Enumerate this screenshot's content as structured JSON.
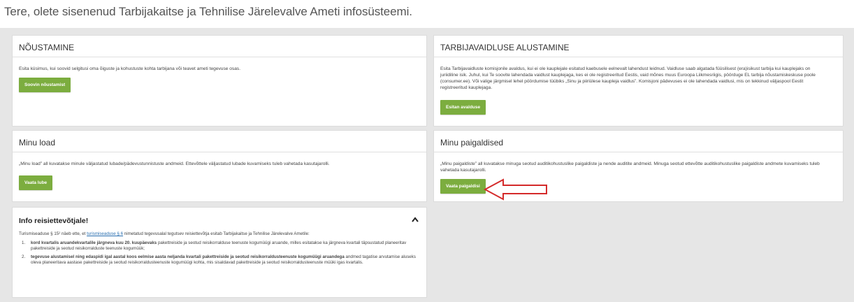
{
  "welcome_text": "Tere, olete sisenenud Tarbijakaitse ja Tehnilise Järelevalve Ameti infosüsteemi.",
  "cards": {
    "noustamine": {
      "title": "NÕUSTAMINE",
      "text": "Esita küsimus, kui soovid selgitusi oma õiguste ja kohustuste kohta tarbijana või teavet ameti tegevuse osas.",
      "button": "Soovin nõustamist"
    },
    "tarbijavaidlus": {
      "title": "TARBIJAVAIDLUSE ALUSTAMINE",
      "text": "Esita Tarbijavaidluste komisjonile avaldus, kui ei ole kauplejale esitatud kaebusele eelnevalt lahendust leidnud. Vaidluse saab algatada füüsilisest (era)isikust tarbija kui kauplejaks on juriidiline isik. Juhul, kui Te soovite lahendada vaidlust kauplejaga, kes ei ole registreeritud Eestis, vaid mõnes muus Euroopa Liikmesriigis, pöörduge EL tarbija nõustamiskeskuse poole (consumer.ee). Või valige järgmisel lehel pöördumise tüübiks „Sinu ja piiriülese kaupleja vaidlus”. Komisjoni pädevuses ei ole lahendada vaidlusi, mis on tekkinud väljaspool Eestit registreeritud kauplejaga.",
      "button": "Esitan avalduse"
    },
    "minu_load": {
      "title": "Minu load",
      "text": "„Minu load” all kuvatakse minule väljastatud lubade/pädevustunnistuste andmeid. Ettevõttele väljastatud lubade kuvamiseks tuleb vahetada kasutajarolli.",
      "button": "Vaata lube"
    },
    "minu_paigaldised": {
      "title": "Minu paigaldised",
      "text": "„Minu paigaldiste” all kuvatakse minuga seotud auditikohustuslike paigaldiste ja nende auditite andmeid. Minuga seotud ettevõtte auditikohustuslike paigaldiste andmete kuvamiseks tuleb vahetada kasutajarolli.",
      "button": "Vaata paigaldisi"
    }
  },
  "info": {
    "title": "Info reisiettevõtjale!",
    "intro_before": "Turismiseaduse § 15² näeb ette, et",
    "intro_link": "turismiseaduse § 6",
    "intro_after": "nimetatud tegevusalal tegutsev reisiettevõtja esitab Tarbijakaitse ja Tehnilise Järelevalve Ametile:",
    "items": [
      {
        "num": "1.",
        "bold": "kord kvartalis aruandekvartalile järgneva kuu 20. kuupäevaks",
        "rest": "pakettreiside ja seotud reisikorralduse teenuste kogumüügi aruande, milles esitatakse ka järgneva kvartali täpsustatud planeeritav pakettreiside ja seotud reisikorralduste teenuste kogumüük;"
      },
      {
        "num": "2.",
        "bold": "tegevuse alustamisel ning edaspidi igal aastal koos eelmise aasta neljanda kvartali pakettreiside ja seotud reisikorraldusteenuste kogumüügi aruandega",
        "rest": "andmed tagatise arvutamise aluseks oleva planeeritava aastase pakettreiside ja seotud reisikorraldusteenuste kogumüügi kohta, mis sisaldavad pakettreiside ja seotud reisikorraldusteenuste müüki igas kvartalis."
      }
    ]
  },
  "colors": {
    "button_green": "#7cad3f",
    "arrow_red": "#d42a2a",
    "background_gray": "#e6e6e6"
  }
}
